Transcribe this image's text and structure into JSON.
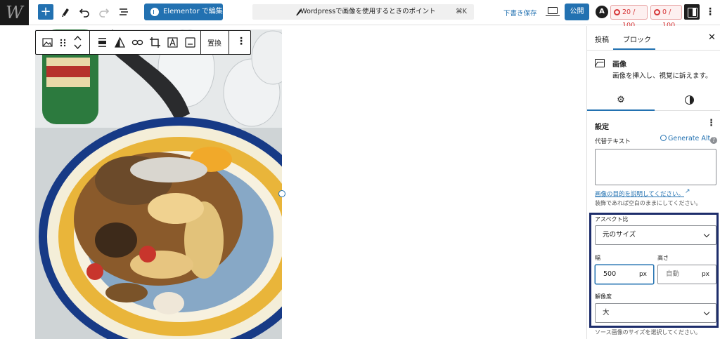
{
  "header": {
    "logo_text": "W",
    "elementor_button": "Elementor で編集",
    "command_bar": {
      "title": "Wordpressで画像を使用するときのポイント",
      "shortcut": "⌘K"
    },
    "save_draft": "下書き保存",
    "publish": "公開",
    "seo_score": "20 / 100",
    "readability_score": "0 / 100",
    "more_icon": "⋮"
  },
  "block_toolbar": {
    "replace": "置換",
    "more": "⋮"
  },
  "sidebar": {
    "tabs": {
      "post": "投稿",
      "block": "ブロック"
    },
    "close": "✕",
    "block_card": {
      "title": "画像",
      "description": "画像を挿入し、視覚に訴えます。"
    },
    "settings_title": "設定",
    "panel_more": "⋮",
    "alt_text": {
      "label": "代替テキスト",
      "generate": "Generate Alt",
      "help_icon": "?",
      "link": "画像の目的を説明してください。",
      "link_icon": "↗",
      "help": "装飾であれば空白のままにしてください。"
    },
    "aspect_ratio": {
      "label": "アスペクト比",
      "value": "元のサイズ"
    },
    "width": {
      "label": "幅",
      "value": "500",
      "unit": "px"
    },
    "height": {
      "label": "高さ",
      "placeholder": "自動",
      "unit": "px"
    },
    "resolution": {
      "label": "解像度",
      "value": "大",
      "help": "ソース画像のサイズを選択してください。"
    }
  },
  "colors": {
    "accent": "#2271b1",
    "highlight": "#1d2d6b",
    "score": "#d63638"
  }
}
